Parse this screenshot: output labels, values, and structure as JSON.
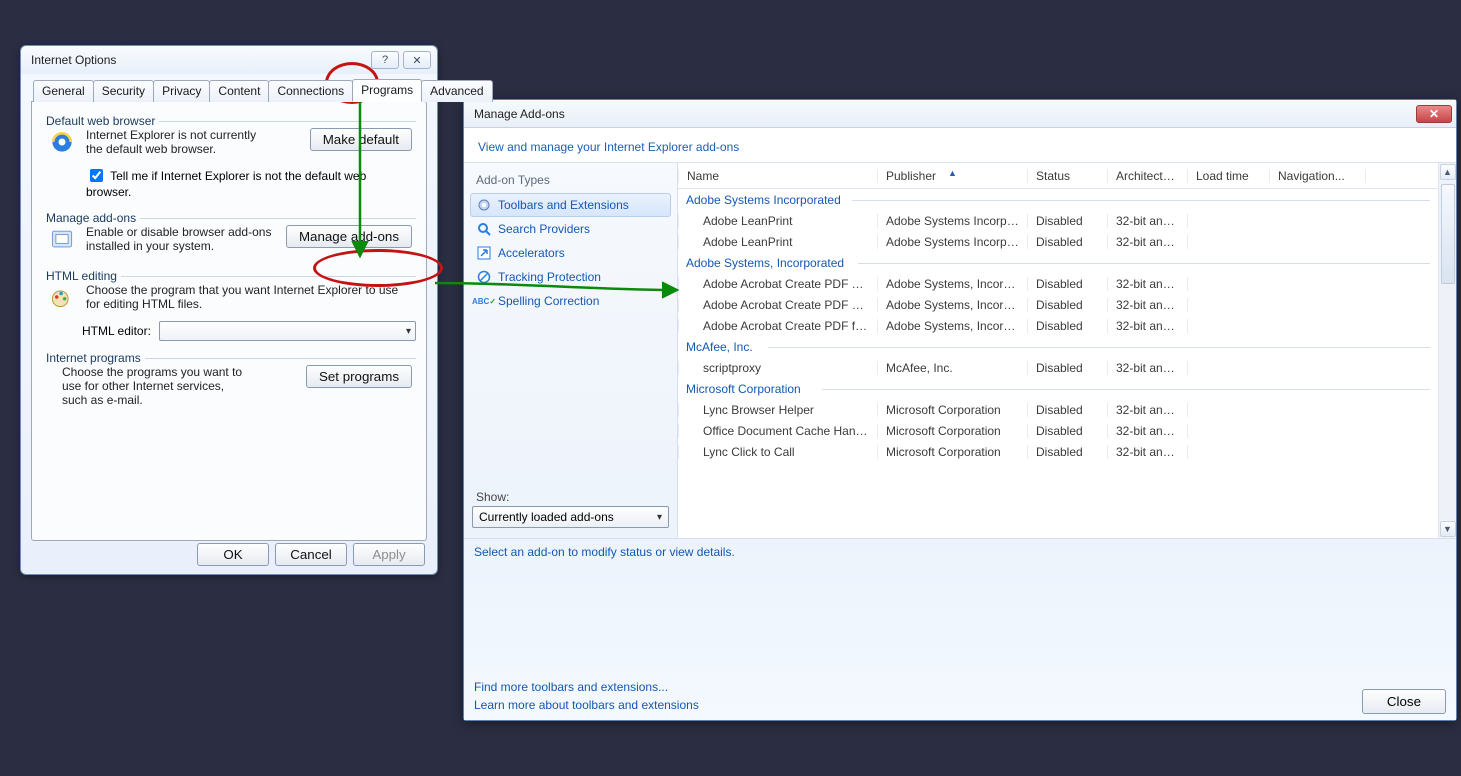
{
  "internetOptions": {
    "title": "Internet Options",
    "helpGlyph": "?",
    "closeGlyph": "✕",
    "tabs": [
      "General",
      "Security",
      "Privacy",
      "Content",
      "Connections",
      "Programs",
      "Advanced"
    ],
    "activeTab": "Programs",
    "groups": {
      "defaultBrowser": {
        "label": "Default web browser",
        "text": "Internet Explorer is not currently the default web browser.",
        "button": "Make default",
        "checkboxText": "Tell me if Internet Explorer is not the default web browser.",
        "checked": true
      },
      "manageAddons": {
        "label": "Manage add-ons",
        "text": "Enable or disable browser add-ons installed in your system.",
        "button": "Manage add-ons"
      },
      "htmlEditing": {
        "label": "HTML editing",
        "text": "Choose the program that you want Internet Explorer to use for editing HTML files.",
        "selectLabel": "HTML editor:"
      },
      "internetPrograms": {
        "label": "Internet programs",
        "text": "Choose the programs you want to use for other Internet services, such as e-mail.",
        "button": "Set programs"
      }
    },
    "footer": {
      "ok": "OK",
      "cancel": "Cancel",
      "apply": "Apply"
    }
  },
  "manageAddons": {
    "title": "Manage Add-ons",
    "subheader": "View and manage your Internet Explorer add-ons",
    "typesHeader": "Add-on Types",
    "types": [
      {
        "icon": "gear",
        "label": "Toolbars and Extensions",
        "active": true
      },
      {
        "icon": "search",
        "label": "Search Providers"
      },
      {
        "icon": "accel",
        "label": "Accelerators"
      },
      {
        "icon": "shield",
        "label": "Tracking Protection"
      },
      {
        "icon": "abc",
        "label": "Spelling Correction"
      }
    ],
    "showLabel": "Show:",
    "showValue": "Currently loaded add-ons",
    "columns": [
      "Name",
      "Publisher",
      "Status",
      "Architecture",
      "Load time",
      "Navigation..."
    ],
    "sortedColumn": "Publisher",
    "groups": [
      {
        "name": "Adobe Systems Incorporated",
        "rows": [
          {
            "name": "Adobe LeanPrint",
            "pub": "Adobe Systems Incorpor...",
            "status": "Disabled",
            "arch": "32-bit and ..."
          },
          {
            "name": "Adobe LeanPrint",
            "pub": "Adobe Systems Incorpor...",
            "status": "Disabled",
            "arch": "32-bit and ..."
          }
        ]
      },
      {
        "name": "Adobe Systems, Incorporated",
        "rows": [
          {
            "name": "Adobe Acrobat Create PDF Too...",
            "pub": "Adobe Systems, Incorpo...",
            "status": "Disabled",
            "arch": "32-bit and ..."
          },
          {
            "name": "Adobe Acrobat Create PDF Hel...",
            "pub": "Adobe Systems, Incorpo...",
            "status": "Disabled",
            "arch": "32-bit and ..."
          },
          {
            "name": "Adobe Acrobat Create PDF fro...",
            "pub": "Adobe Systems, Incorpo...",
            "status": "Disabled",
            "arch": "32-bit and ..."
          }
        ]
      },
      {
        "name": "McAfee, Inc.",
        "rows": [
          {
            "name": "scriptproxy",
            "pub": "McAfee, Inc.",
            "status": "Disabled",
            "arch": "32-bit and ..."
          }
        ]
      },
      {
        "name": "Microsoft Corporation",
        "rows": [
          {
            "name": "Lync Browser Helper",
            "pub": "Microsoft Corporation",
            "status": "Disabled",
            "arch": "32-bit and ..."
          },
          {
            "name": "Office Document Cache Handler",
            "pub": "Microsoft Corporation",
            "status": "Disabled",
            "arch": "32-bit and ..."
          },
          {
            "name": "Lync Click to Call",
            "pub": "Microsoft Corporation",
            "status": "Disabled",
            "arch": "32-bit and ..."
          }
        ]
      }
    ],
    "detailHint": "Select an add-on to modify status or view details.",
    "link1": "Find more toolbars and extensions...",
    "link2": "Learn more about toolbars and extensions",
    "closeButton": "Close"
  }
}
